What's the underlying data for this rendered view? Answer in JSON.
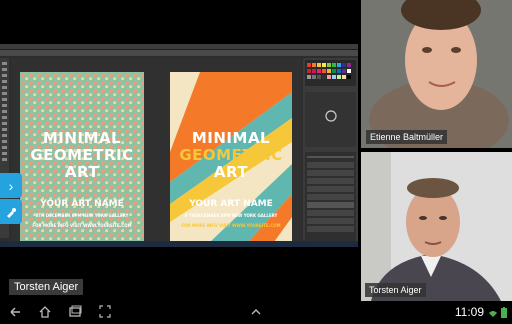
{
  "participants": {
    "video_top_name": "Etienne Baltmüller",
    "video_bottom_name": "Torsten Aiger",
    "presenter_name": "Torsten Aiger"
  },
  "posters": {
    "left": {
      "title_line1": "MINIMAL",
      "title_line2": "GEOMETRIC",
      "title_line3": "ART",
      "subtitle": "YOUR ART NAME",
      "info_line1": "8TH DECEMBER 8PM NEW YORK GALLERY",
      "info_line2": "FOR MORE INFO VISIT WWW.YOURSITE.COM"
    },
    "right": {
      "title_line1": "MINIMAL",
      "title_line2": "GEOMETRIC",
      "title_line3": "ART",
      "subtitle": "YOUR ART NAME",
      "info_line1": "8 THDECEMBER 8PM NEW YORK GALLERY",
      "info_line2": "FOR MORE INFO VISIT WWW.YOURSITE.COM"
    }
  },
  "status": {
    "time": "11:09"
  },
  "icons": {
    "side_tab_1": "chevron-right-icon",
    "side_tab_2": "pen-tool-icon",
    "back": "back-icon",
    "home": "home-icon",
    "recents": "recents-icon",
    "screenshot": "screenshot-icon",
    "up": "chevron-up-icon",
    "wifi": "wifi-icon",
    "battery": "battery-icon"
  },
  "colors": {
    "accent": "#25a3de",
    "poster_orange": "#f47a2a",
    "poster_yellow": "#f7c73a",
    "poster_teal": "#5fb7b0"
  }
}
